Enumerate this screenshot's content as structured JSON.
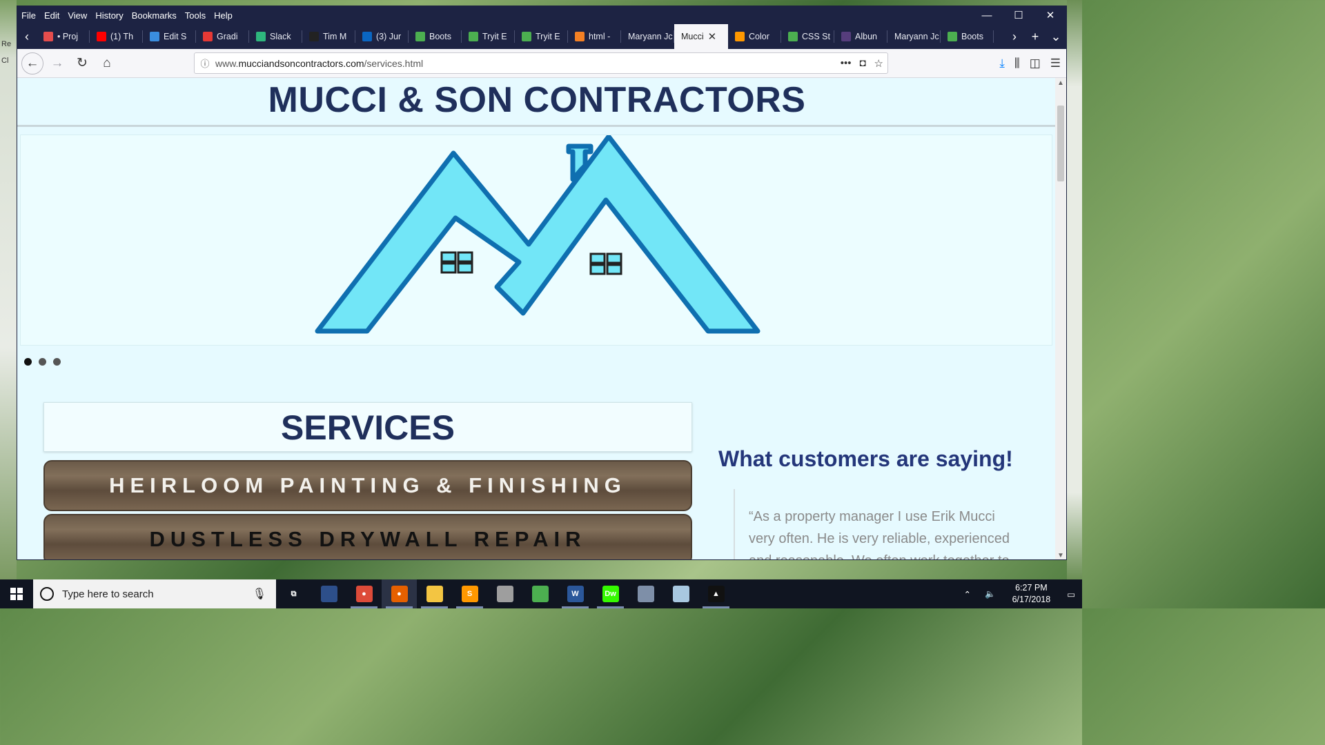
{
  "desktop": {
    "left_frags": [
      "Re",
      "Cl"
    ],
    "right_frags": []
  },
  "browser": {
    "menu": [
      "File",
      "Edit",
      "View",
      "History",
      "Bookmarks",
      "Tools",
      "Help"
    ],
    "tabs": [
      {
        "label": "• Proj",
        "color": "#e44d4d",
        "icon": "tab-icon"
      },
      {
        "label": "(1) Th",
        "color": "#ff0000",
        "icon": "youtube-icon"
      },
      {
        "label": "Edit S",
        "color": "#3a8dde",
        "icon": "tab-icon"
      },
      {
        "label": "Gradi",
        "color": "#e53935",
        "icon": "tab-icon"
      },
      {
        "label": "Slack",
        "color": "#2eb67d",
        "icon": "slack-icon"
      },
      {
        "label": "Tim M",
        "color": "#222222",
        "icon": "tab-icon"
      },
      {
        "label": "(3) Jur",
        "color": "#0a66c2",
        "icon": "linkedin-icon"
      },
      {
        "label": "Boots",
        "color": "#4caf50",
        "icon": "w3-icon"
      },
      {
        "label": "Tryit E",
        "color": "#4caf50",
        "icon": "w3-icon"
      },
      {
        "label": "Tryit E",
        "color": "#4caf50",
        "icon": "w3-icon"
      },
      {
        "label": "html -",
        "color": "#f48024",
        "icon": "stackoverflow-icon"
      },
      {
        "label": "Maryann Jc",
        "color": "",
        "icon": ""
      },
      {
        "label": "Mucci",
        "color": "",
        "icon": "",
        "active": true
      },
      {
        "label": "Color",
        "color": "#ff9800",
        "icon": "tab-icon"
      },
      {
        "label": "CSS St",
        "color": "#4caf50",
        "icon": "w3-icon"
      },
      {
        "label": "Albun",
        "color": "#563d7c",
        "icon": "bootstrap-icon"
      },
      {
        "label": "Maryann Jc",
        "color": "",
        "icon": ""
      },
      {
        "label": "Boots",
        "color": "#4caf50",
        "icon": "w3-icon"
      }
    ],
    "url": {
      "prefix": "www.",
      "domain": "mucciandsoncontractors.com",
      "path": "/services.html"
    }
  },
  "page": {
    "site_title": "MUCCI & SON CONTRACTORS",
    "carousel": {
      "slides": 3,
      "active_index": 0
    },
    "services_heading": "SERVICES",
    "services": [
      "HEIRLOOM PAINTING & FINISHING",
      "DUSTLESS DRYWALL REPAIR"
    ],
    "testimonials_heading": "What customers are saying!",
    "testimonial_quote": "“As a property manager I use Erik Mucci very often. He is very reliable, experienced and reasonable. We often work together to"
  },
  "taskbar": {
    "search_placeholder": "Type here to search",
    "time": "6:27 PM",
    "date": "6/17/2018",
    "apps": [
      {
        "name": "task-view-icon",
        "color": "#101521",
        "label": "⧉"
      },
      {
        "name": "app-icon-blue",
        "color": "#2d4f8a",
        "label": ""
      },
      {
        "name": "chrome-icon",
        "color": "#dd4b39",
        "label": "●"
      },
      {
        "name": "firefox-icon",
        "color": "#e66000",
        "label": "●",
        "active": true
      },
      {
        "name": "file-explorer-icon",
        "color": "#f3c542",
        "label": ""
      },
      {
        "name": "sublime-icon",
        "color": "#ff9800",
        "label": "S"
      },
      {
        "name": "paint-icon",
        "color": "#9e9e9e",
        "label": ""
      },
      {
        "name": "git-icon",
        "color": "#4caf50",
        "label": ""
      },
      {
        "name": "word-icon",
        "color": "#2b579a",
        "label": "W"
      },
      {
        "name": "dreamweaver-icon",
        "color": "#35fa00",
        "label": "Dw"
      },
      {
        "name": "paint3d-icon",
        "color": "#7e8fa8",
        "label": ""
      },
      {
        "name": "app-icon-light",
        "color": "#a8c8e0",
        "label": ""
      },
      {
        "name": "photos-icon",
        "color": "#111111",
        "label": "▲"
      }
    ]
  }
}
